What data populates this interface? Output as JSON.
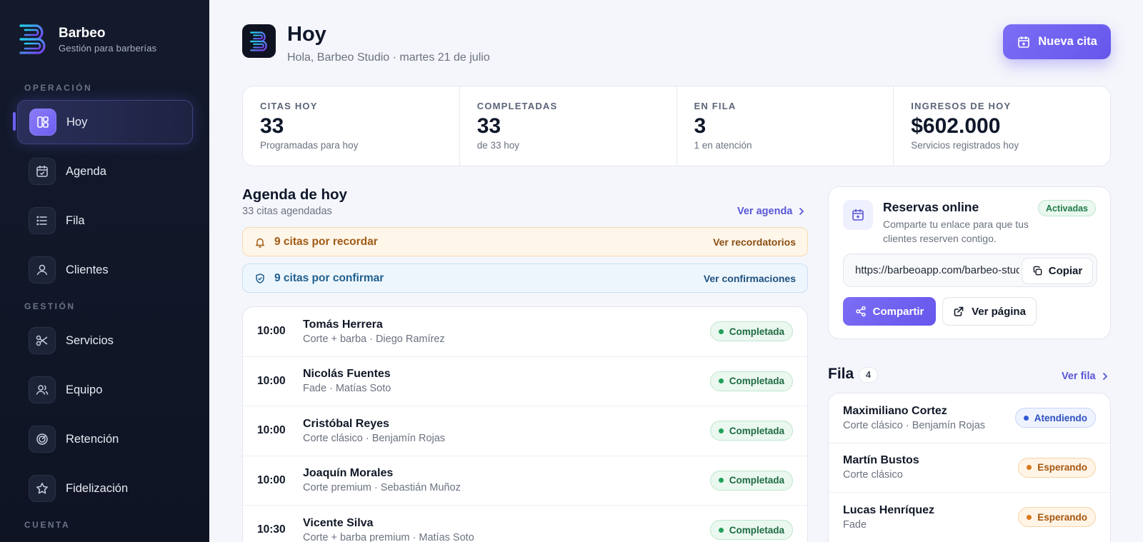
{
  "brand": {
    "name": "Barbeo",
    "tagline": "Gestión para barberías"
  },
  "sidebar": {
    "sections": {
      "operacion": "OPERACIÓN",
      "gestion": "GESTIÓN",
      "cuenta": "CUENTA"
    },
    "items": [
      {
        "label": "Hoy",
        "icon": "dashboard-icon",
        "active": true
      },
      {
        "label": "Agenda",
        "icon": "calendar-icon"
      },
      {
        "label": "Fila",
        "icon": "list-icon"
      },
      {
        "label": "Clientes",
        "icon": "user-icon"
      },
      {
        "label": "Servicios",
        "icon": "scissors-icon"
      },
      {
        "label": "Equipo",
        "icon": "users-icon"
      },
      {
        "label": "Retención",
        "icon": "target-icon"
      },
      {
        "label": "Fidelización",
        "icon": "star-icon"
      }
    ]
  },
  "header": {
    "title": "Hoy",
    "subtitle": "Hola, Barbeo Studio · martes 21 de julio",
    "new_appointment": "Nueva cita"
  },
  "stats": [
    {
      "label": "CITAS HOY",
      "value": "33",
      "note": "Programadas para hoy"
    },
    {
      "label": "COMPLETADAS",
      "value": "33",
      "note": "de 33 hoy"
    },
    {
      "label": "EN FILA",
      "value": "3",
      "note": "1 en atención"
    },
    {
      "label": "INGRESOS DE HOY",
      "value": "$602.000",
      "note": "Servicios registrados hoy"
    }
  ],
  "agenda": {
    "title": "Agenda de hoy",
    "subtitle": "33 citas agendadas",
    "view_link": "Ver agenda",
    "reminders": {
      "text": "9 citas por recordar",
      "action": "Ver recordatorios"
    },
    "confirmations": {
      "text": "9 citas por confirmar",
      "action": "Ver confirmaciones"
    },
    "appointments": [
      {
        "time": "10:00",
        "name": "Tomás Herrera",
        "detail": "Corte + barba · Diego Ramírez",
        "status": "Completada"
      },
      {
        "time": "10:00",
        "name": "Nicolás Fuentes",
        "detail": "Fade · Matías Soto",
        "status": "Completada"
      },
      {
        "time": "10:00",
        "name": "Cristóbal Reyes",
        "detail": "Corte clásico · Benjamín Rojas",
        "status": "Completada"
      },
      {
        "time": "10:00",
        "name": "Joaquín Morales",
        "detail": "Corte premium · Sebastián Muñoz",
        "status": "Completada"
      },
      {
        "time": "10:30",
        "name": "Vicente Silva",
        "detail": "Corte + barba premium · Matías Soto",
        "status": "Completada"
      }
    ]
  },
  "reservas": {
    "title": "Reservas online",
    "description": "Comparte tu enlace para que tus clientes reserven contigo.",
    "status": "Activadas",
    "url": "https://barbeoapp.com/barbeo-studio",
    "copy": "Copiar",
    "share": "Compartir",
    "view_page": "Ver página"
  },
  "fila": {
    "title": "Fila",
    "count": "4",
    "view_link": "Ver fila",
    "items": [
      {
        "name": "Maximiliano Cortez",
        "detail": "Corte clásico · Benjamín Rojas",
        "status": "Atendiendo",
        "tone": "blue"
      },
      {
        "name": "Martín Bustos",
        "detail": "Corte clásico",
        "status": "Esperando",
        "tone": "orange"
      },
      {
        "name": "Lucas Henríquez",
        "detail": "Fade",
        "status": "Esperando",
        "tone": "orange"
      }
    ]
  },
  "colors": {
    "accent": "#6d5ff0",
    "sidebar": "#141a2c",
    "success": "#22a05a",
    "warning": "#d9781c",
    "info": "#3358d4"
  }
}
